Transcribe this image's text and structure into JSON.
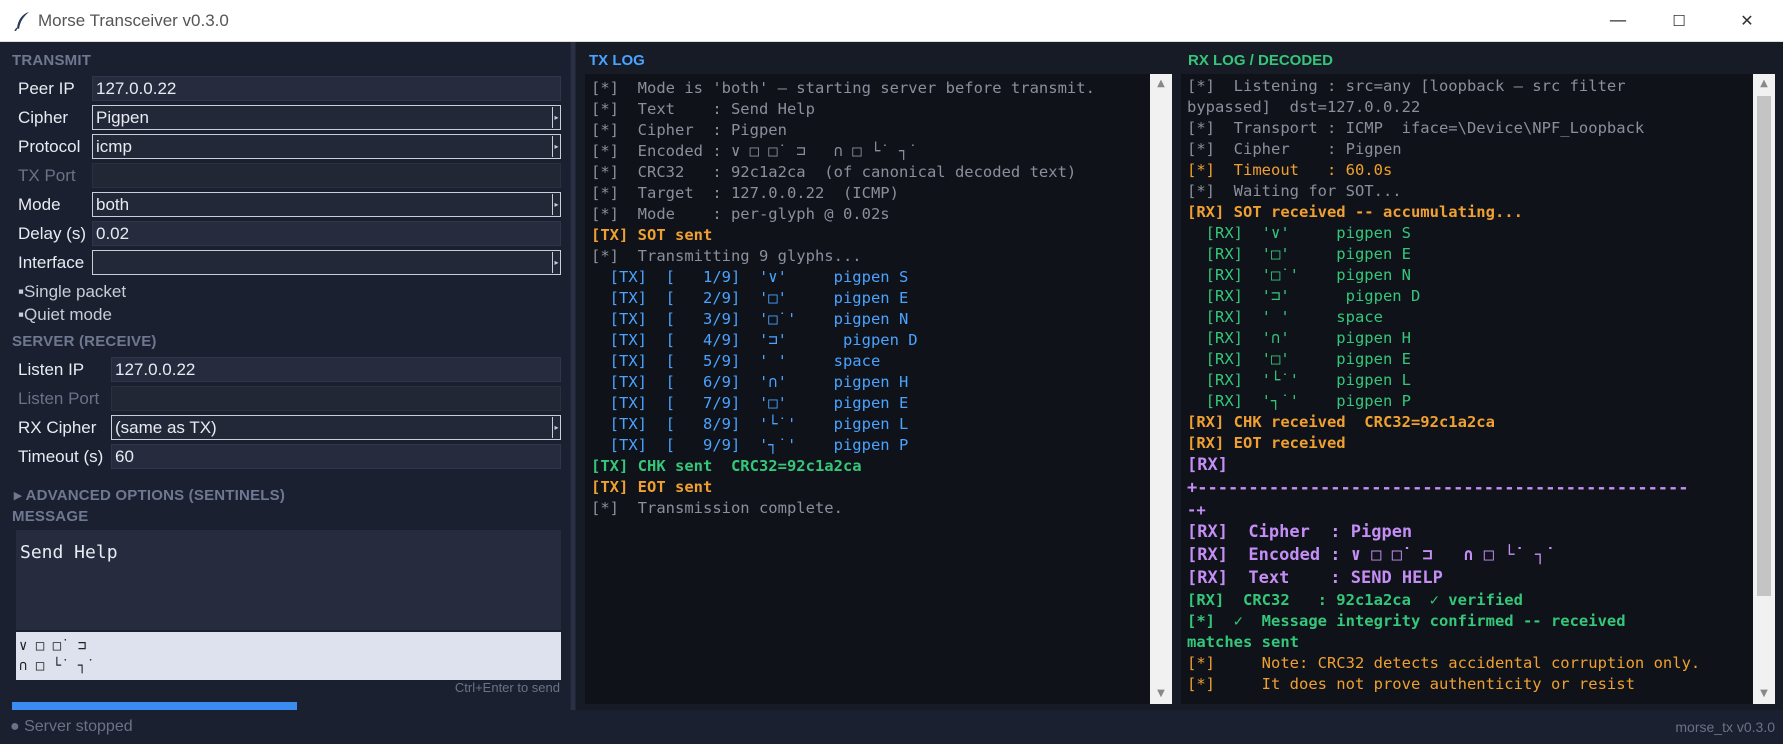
{
  "window": {
    "title": "Morse Transceiver  v0.3.0",
    "minimize": "—",
    "maximize": "☐",
    "close": "✕"
  },
  "transmit": {
    "header": "TRANSMIT",
    "peer_ip_label": "Peer IP",
    "peer_ip": "127.0.0.22",
    "cipher_label": "Cipher",
    "cipher": "Pigpen",
    "protocol_label": "Protocol",
    "protocol": "icmp",
    "tx_port_label": "TX Port",
    "tx_port": "",
    "mode_label": "Mode",
    "mode": "both",
    "delay_label": "Delay (s)",
    "delay": "0.02",
    "interface_label": "Interface",
    "interface": "",
    "single_packet": "▪Single packet",
    "quiet_mode": "▪Quiet mode"
  },
  "server": {
    "header": "SERVER  (RECEIVE)",
    "listen_ip_label": "Listen IP",
    "listen_ip": "127.0.0.22",
    "listen_port_label": "Listen Port",
    "listen_port": "",
    "rx_cipher_label": "RX Cipher",
    "rx_cipher": "(same as TX)",
    "timeout_label": "Timeout (s)",
    "timeout": "60"
  },
  "advanced": {
    "label": "▸  ADVANCED OPTIONS  (SENTINELS)"
  },
  "message": {
    "header": "MESSAGE",
    "text": "Send Help",
    "preview_line1": "∨ □ □˙ ⊐",
    "preview_line2": "∩ □ └˙ ┐˙",
    "hint": "Ctrl+Enter to send"
  },
  "tx_log": {
    "header": "TX LOG",
    "lines": [
      {
        "t": "[*]  Mode is 'both' — starting server before transmit.",
        "c": "gray"
      },
      {
        "t": "[*]  Text    : Send Help",
        "c": "gray"
      },
      {
        "t": "[*]  Cipher  : Pigpen",
        "c": "gray"
      },
      {
        "t": "[*]  Encoded : ∨ □ □˙ ⊐   ∩ □ └˙ ┐˙",
        "c": "gray"
      },
      {
        "t": "[*]  CRC32   : 92c1a2ca  (of canonical decoded text)",
        "c": "gray"
      },
      {
        "t": "[*]  Target  : 127.0.0.22  (ICMP)",
        "c": "gray"
      },
      {
        "t": "[*]  Mode    : per-glyph @ 0.02s",
        "c": "gray"
      },
      {
        "t": "[TX] SOT sent",
        "c": "orange"
      },
      {
        "t": "[*]  Transmitting 9 glyphs...",
        "c": "gray"
      },
      {
        "t": "  [TX]  [   1/9]  '∨'     pigpen S",
        "c": "blue"
      },
      {
        "t": "  [TX]  [   2/9]  '□'     pigpen E",
        "c": "blue"
      },
      {
        "t": "  [TX]  [   3/9]  '□˙'    pigpen N",
        "c": "blue"
      },
      {
        "t": "  [TX]  [   4/9]  '⊐'      pigpen D",
        "c": "blue"
      },
      {
        "t": "  [TX]  [   5/9]  ' '     space",
        "c": "blue"
      },
      {
        "t": "  [TX]  [   6/9]  '∩'     pigpen H",
        "c": "blue"
      },
      {
        "t": "  [TX]  [   7/9]  '□'     pigpen E",
        "c": "blue"
      },
      {
        "t": "  [TX]  [   8/9]  '└˙'    pigpen L",
        "c": "blue"
      },
      {
        "t": "  [TX]  [   9/9]  '┐˙'    pigpen P",
        "c": "blue"
      },
      {
        "t": "[TX] CHK sent  CRC32=92c1a2ca",
        "c": "greenb"
      },
      {
        "t": "[TX] EOT sent",
        "c": "orange"
      },
      {
        "t": "[*]  Transmission complete.",
        "c": "gray"
      }
    ]
  },
  "rx_log": {
    "header": "RX LOG  /  DECODED",
    "lines": [
      {
        "t": "[*]  Listening : src=any [loopback — src filter",
        "c": "gray"
      },
      {
        "t": "bypassed]  dst=127.0.0.22",
        "c": "gray"
      },
      {
        "t": "[*]  Transport : ICMP  iface=\\Device\\NPF_Loopback",
        "c": "gray"
      },
      {
        "t": "[*]  Cipher    : Pigpen",
        "c": "gray"
      },
      {
        "t": "[*]  Timeout   : 60.0s",
        "c": "orange-n"
      },
      {
        "t": "[*]  Waiting for SOT...",
        "c": "gray"
      },
      {
        "t": "[RX] SOT received -- accumulating...",
        "c": "orange"
      },
      {
        "t": "  [RX]  '∨'     pigpen S",
        "c": "green"
      },
      {
        "t": "  [RX]  '□'     pigpen E",
        "c": "green"
      },
      {
        "t": "  [RX]  '□˙'    pigpen N",
        "c": "green"
      },
      {
        "t": "  [RX]  '⊐'      pigpen D",
        "c": "green"
      },
      {
        "t": "  [RX]  ' '     space",
        "c": "green"
      },
      {
        "t": "  [RX]  '∩'     pigpen H",
        "c": "green"
      },
      {
        "t": "  [RX]  '□'     pigpen E",
        "c": "green"
      },
      {
        "t": "  [RX]  '└˙'    pigpen L",
        "c": "green"
      },
      {
        "t": "  [RX]  '┐˙'    pigpen P",
        "c": "green"
      },
      {
        "t": "[RX] CHK received  CRC32=92c1a2ca",
        "c": "orange"
      },
      {
        "t": "[RX] EOT received",
        "c": "orange"
      },
      {
        "t": "[RX]",
        "c": "purple-big"
      },
      {
        "t": "+------------------------------------------------",
        "c": "purple-big"
      },
      {
        "t": "-+",
        "c": "purple"
      },
      {
        "t": "[RX]  Cipher  : Pigpen",
        "c": "purple-big"
      },
      {
        "t": "[RX]  Encoded : ∨ □ □˙ ⊐   ∩ □ └˙ ┐˙",
        "c": "purple-big"
      },
      {
        "t": "[RX]  Text    : SEND HELP",
        "c": "purple-big"
      },
      {
        "t": "[RX]  CRC32   : 92c1a2ca  ✓ verified",
        "c": "greenb"
      },
      {
        "t": "[*]  ✓  Message integrity confirmed -- received",
        "c": "greenb"
      },
      {
        "t": "matches sent",
        "c": "greenb"
      },
      {
        "t": "[*]     Note: CRC32 detects accidental corruption only.",
        "c": "orange-n"
      },
      {
        "t": "[*]     It does not prove authenticity or resist",
        "c": "orange-n"
      }
    ]
  },
  "status": {
    "left": "● Server stopped",
    "right": "morse_tx v0.3.0"
  },
  "colors": {
    "bg": "#171b26",
    "panel": "#1b2030",
    "console": "#0f1219",
    "tx_header": "#4aa3ff",
    "rx_header": "#34c77a",
    "accent_button": "#3a8cf0"
  }
}
